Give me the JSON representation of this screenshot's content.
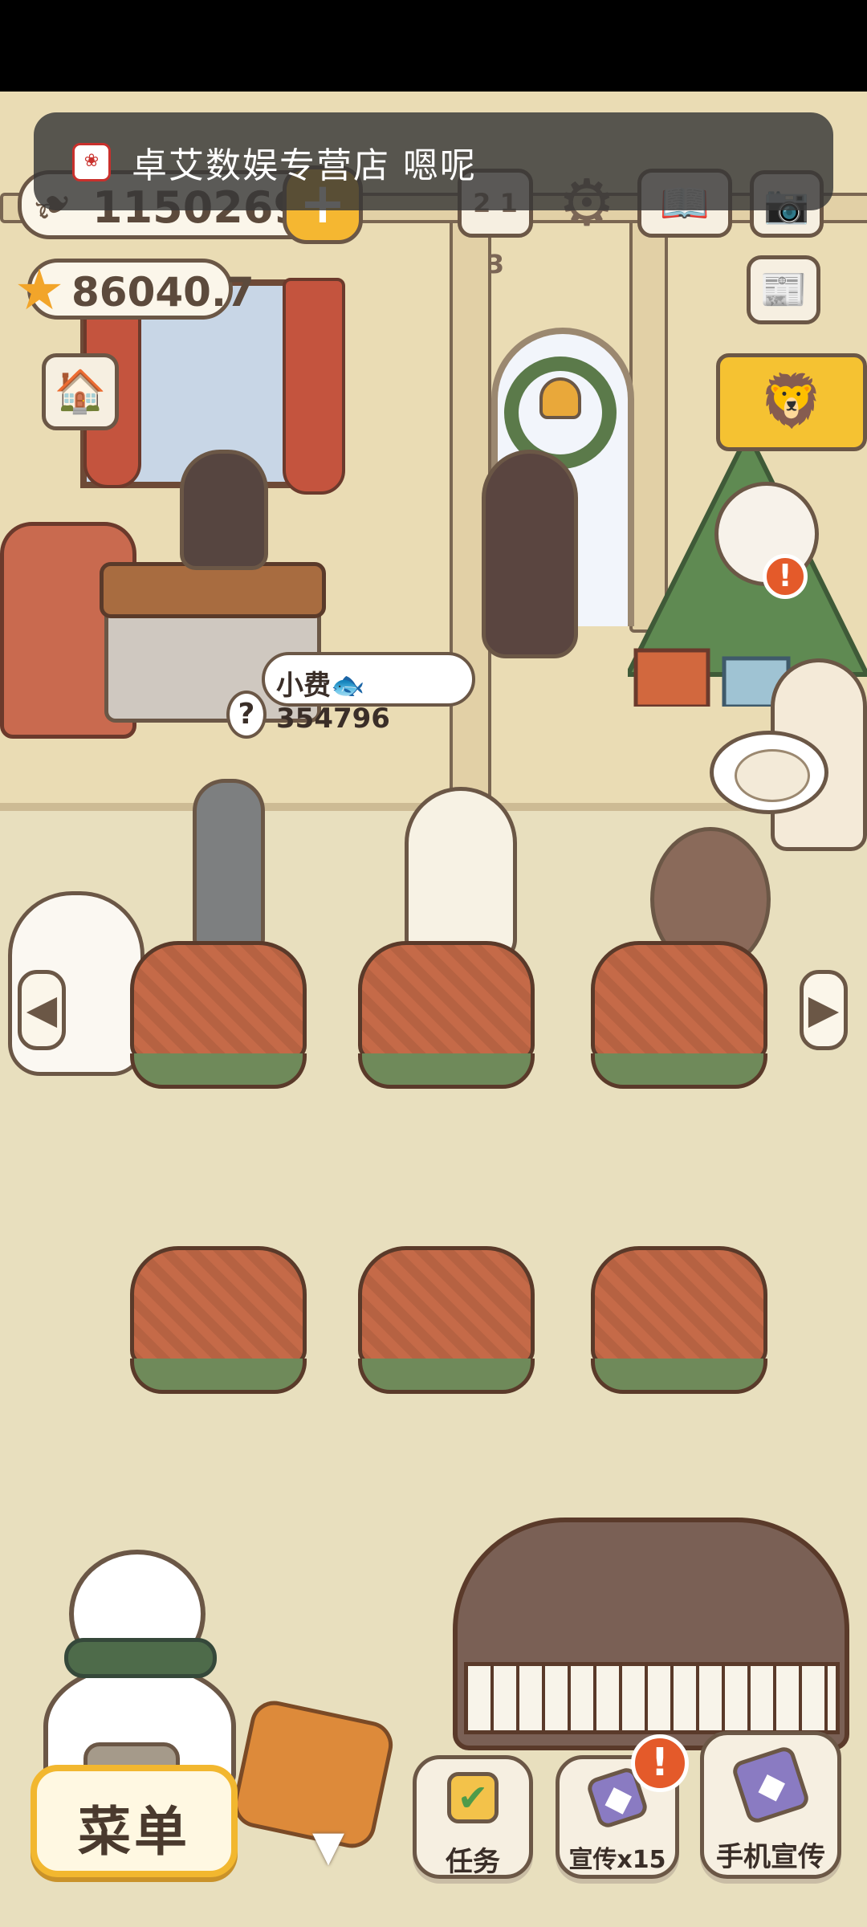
{
  "status_bar": {},
  "notification": {
    "app_icon": "store-logo-icon",
    "text": "卓艾数娱专营店  嗯呢"
  },
  "currencies": {
    "fish": "115026900",
    "star": "86040.7",
    "plus_glyph": "+"
  },
  "top_buttons": [
    {
      "name": "ranking-icon",
      "glyph": "2 1 3"
    },
    {
      "name": "settings-gear-icon",
      "glyph": "⚙"
    },
    {
      "name": "pawprint-book-icon",
      "glyph": "📖"
    },
    {
      "name": "camera-icon",
      "glyph": "📷"
    }
  ],
  "side_buttons": [
    {
      "name": "shop-icon",
      "glyph": "🏠"
    },
    {
      "name": "newspaper-icon",
      "glyph": "📰"
    },
    {
      "name": "lion-dance-event-icon",
      "glyph": "🦁"
    }
  ],
  "scene": {
    "tip_bubble": {
      "text": "小费🐟354796"
    },
    "order_bubble": {
      "icon": "food-plate-icon"
    },
    "alert_on_cat": "!"
  },
  "navigation": {
    "left_arrow": "◀",
    "right_arrow": "▶"
  },
  "tables": {
    "count": 6
  },
  "bottom_bar": {
    "menu_label": "菜单",
    "collapse_glyph": "▼",
    "task_label": "任务",
    "promote_label": "宣传x15",
    "promote_badge": "!",
    "phone_promote_label": "手机宣传"
  },
  "colors": {
    "accent_yellow": "#f2b72f",
    "outline_brown": "#6b5746",
    "alert_orange": "#e45a2a",
    "table_red": "#c56a48"
  }
}
